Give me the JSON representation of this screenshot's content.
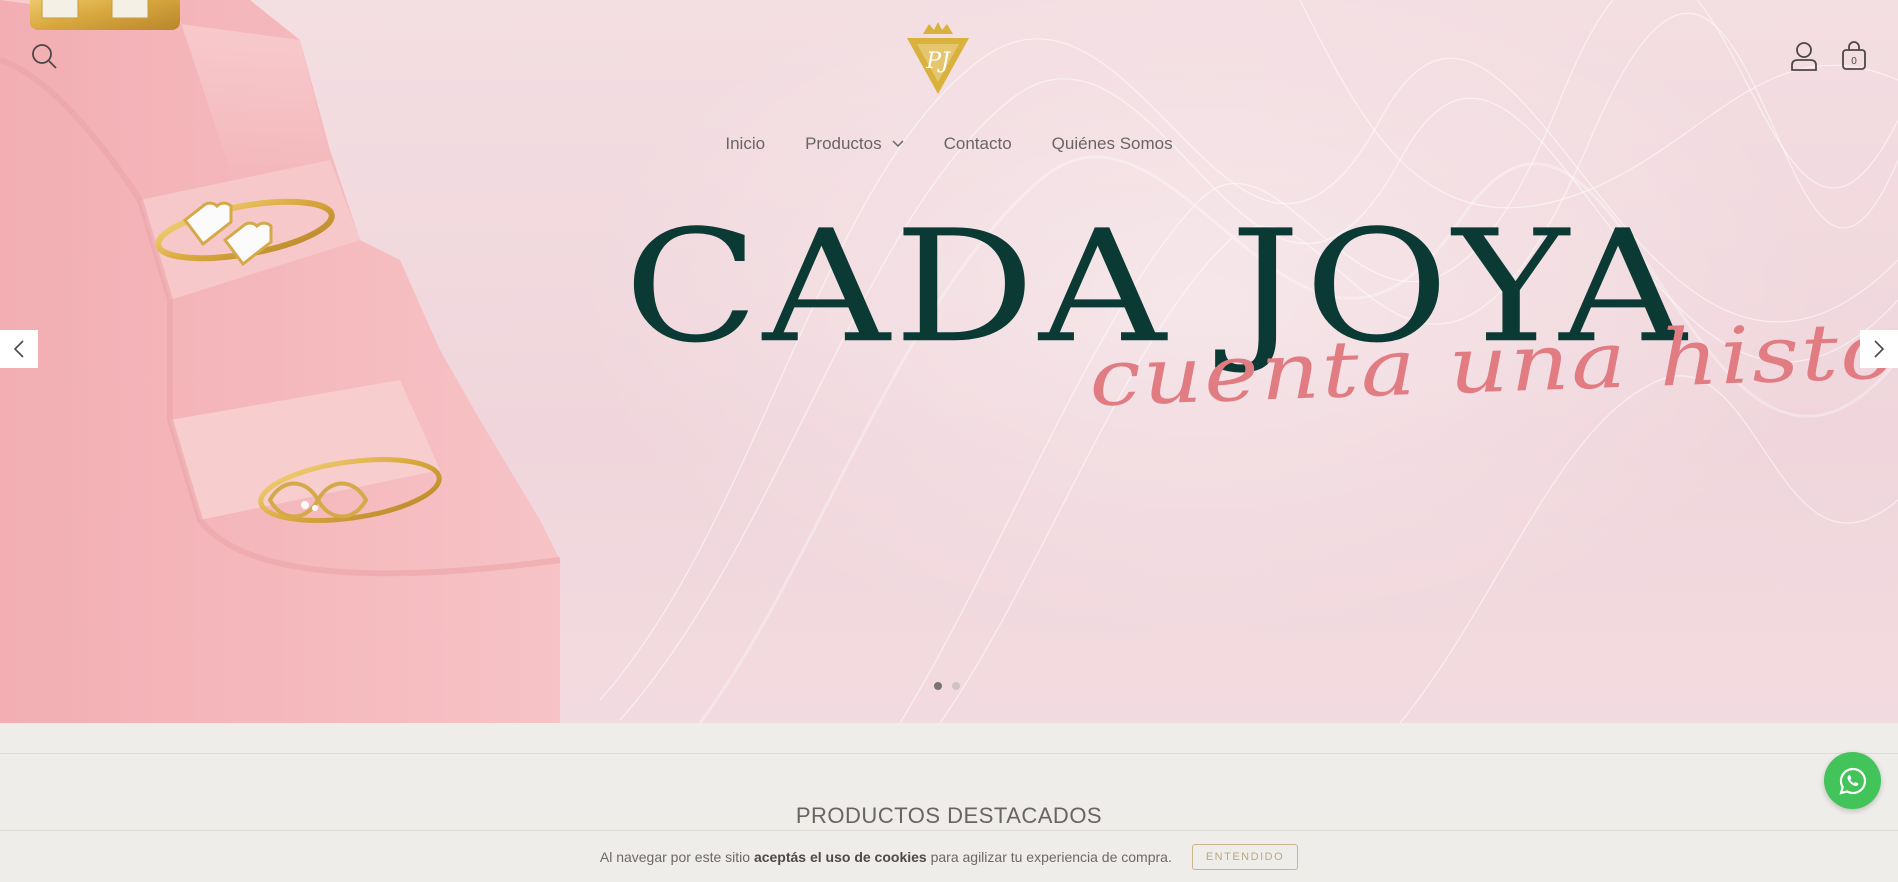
{
  "header": {
    "search_icon": "search-icon",
    "account_icon": "user-icon",
    "cart_icon": "shopping-bag-icon",
    "cart_count": "0",
    "logo_icon": "crown-logo",
    "brand_color": "#d8b23c"
  },
  "nav": {
    "items": [
      {
        "label": "Inicio"
      },
      {
        "label": "Productos",
        "has_dropdown": true
      },
      {
        "label": "Contacto"
      },
      {
        "label": "Quiénes Somos"
      }
    ]
  },
  "hero": {
    "headline": "CADA JOYA",
    "subline": "cuenta una historia",
    "headline_color": "#0b3a34",
    "subline_color": "#e07c82",
    "slides_count": 2,
    "active_slide": 1
  },
  "featured": {
    "title": "PRODUCTOS DESTACADOS"
  },
  "cookie": {
    "text_before": "Al navegar por este sitio ",
    "text_bold": "aceptás el uso de cookies",
    "text_after": " para agilizar tu experiencia de compra.",
    "button_label": "ENTENDIDO"
  },
  "whatsapp": {
    "icon": "whatsapp-icon",
    "color": "#43c45a"
  }
}
